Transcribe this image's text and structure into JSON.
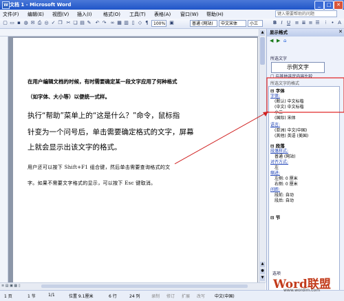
{
  "window": {
    "title": "文档 1 - Microsoft Word",
    "icon": "word-app-icon"
  },
  "menubar": {
    "items": [
      "文件(F)",
      "编辑(E)",
      "视图(V)",
      "插入(I)",
      "格式(O)",
      "工具(T)",
      "表格(A)",
      "窗口(W)",
      "帮助(H)"
    ],
    "help_placeholder": "键入需要帮助的问题"
  },
  "toolbar": {
    "style_combo": "普通 (网站)",
    "font_combo": "中文宋体",
    "size_combo": "小三",
    "zoom": "100%",
    "bold": "B",
    "italic": "I",
    "underline": "U"
  },
  "document": {
    "heading1": "在用户编辑文档的时候，有时需要确定某一段文字应用了何种格式",
    "heading2": "（如字体、大小等）以便统一式样。",
    "para1_l1": "执行“帮助”菜单上的“这是什么？”命令，鼠标指",
    "para1_l2": "针变为一个问号后，单击需要确定格式的文字，屏幕",
    "para1_l3": "上就会显示出该文字的格式。",
    "para2_l1": "用户还可以按下 Shift+F1 组合键，然后单击需要查询格式的文",
    "para2_l2": "字。如果不需要文字格式的显示，可以按下 Esc 键取消。"
  },
  "taskpane": {
    "title": "显示格式",
    "selected_label": "所选文字",
    "sample_text": "示例文字",
    "compare_label": "与其他选定内容比较",
    "format_label": "所选文字的格式",
    "font_section": {
      "title": "字体",
      "link": "字体:",
      "lines": [
        "(默认) 中文标楷",
        "(中文) 中文标楷",
        "小三",
        "(国际) 宋体"
      ]
    },
    "language_section": {
      "link": "语言:",
      "lines": [
        "(亚洲) 中文(中国)",
        "(其他) 英语 (美国)"
      ]
    },
    "para_section": {
      "title": "段落",
      "link1": "段落样式:",
      "style": "普通 (网站)",
      "link2": "对齐方式:",
      "align": "左",
      "link3": "缩进:",
      "indent_left": "左侧: 0 厘米",
      "indent_right": "右侧: 0 厘米",
      "link4": "间距:",
      "space_before": "段前: 自动",
      "space_after": "段后: 自动"
    },
    "section_section": {
      "title": "节"
    },
    "options_label": "选项"
  },
  "statusbar": {
    "page": "1 页",
    "section": "1 节",
    "page_of": "1/1",
    "position": "位置 9.1厘米",
    "line": "6 行",
    "col": "24 列",
    "rec": "录制",
    "trk": "修订",
    "ext": "扩展",
    "ovr": "改写",
    "lang": "中文(中国)"
  },
  "watermark": {
    "brand": "Word联盟",
    "url": "www.wordlm.com"
  }
}
